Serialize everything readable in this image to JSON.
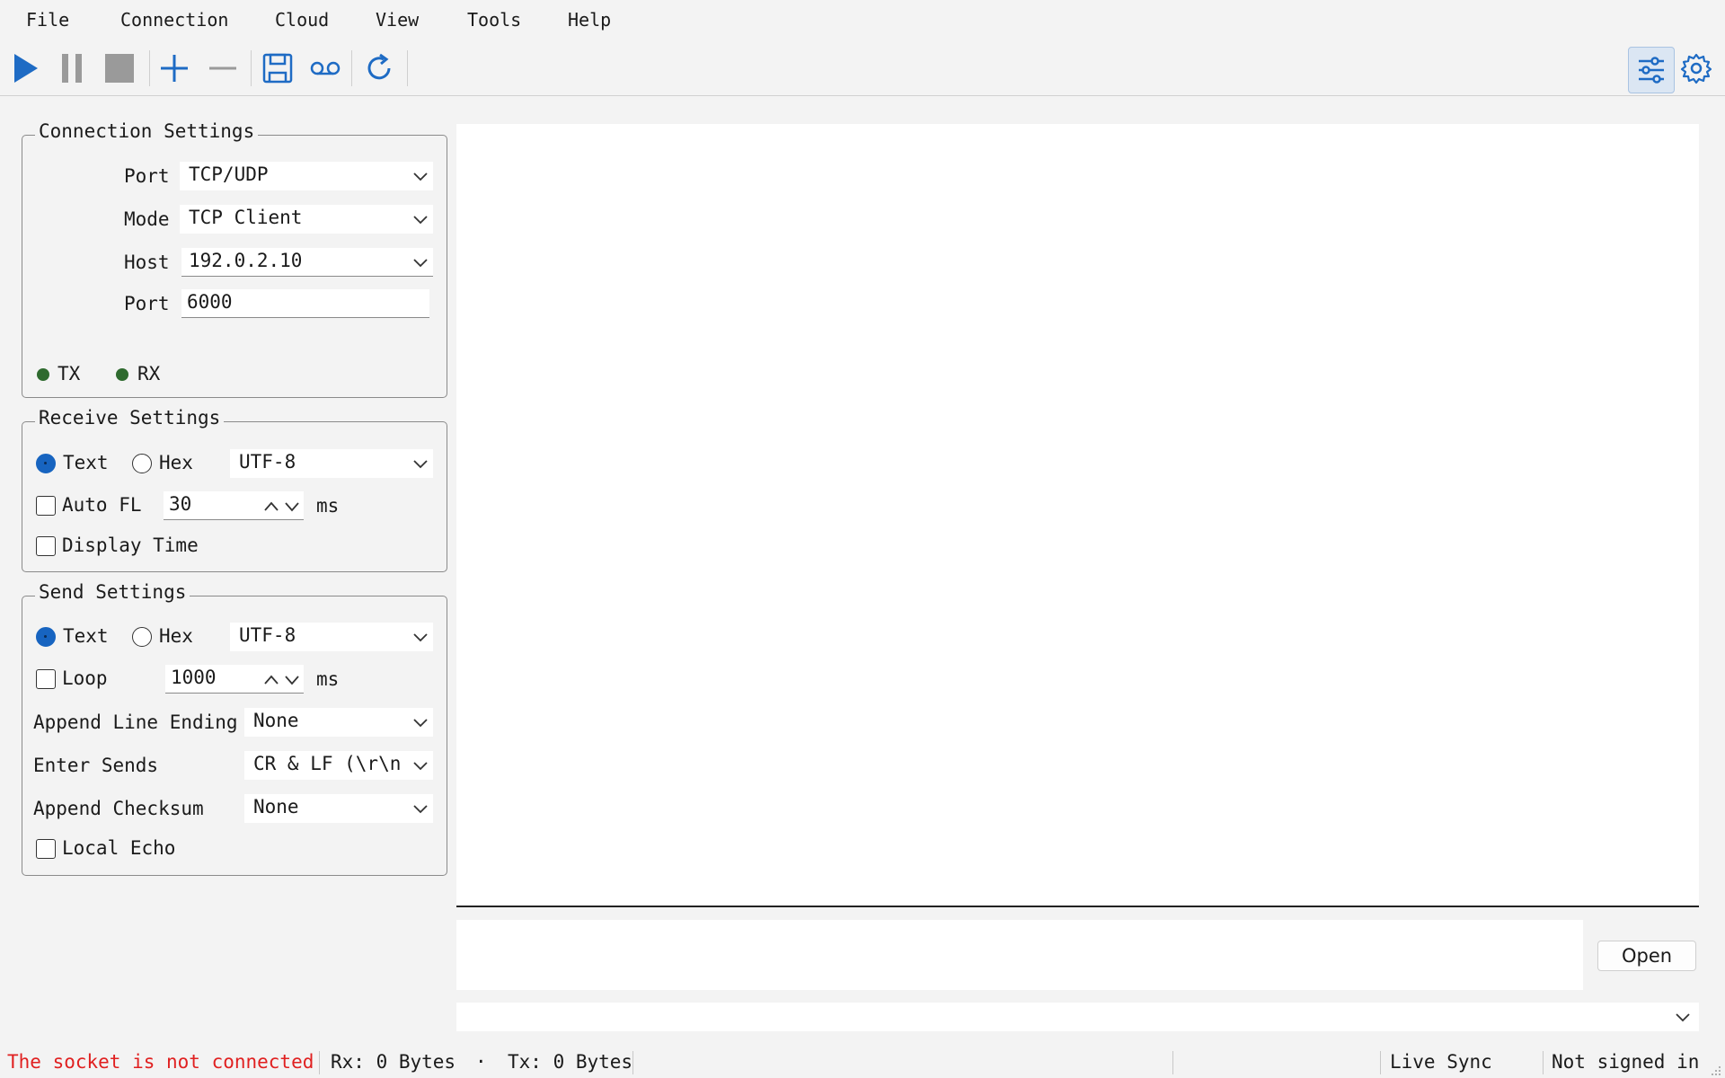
{
  "menu": [
    "File",
    "Connection",
    "Cloud",
    "View",
    "Tools",
    "Help"
  ],
  "toolbar": {
    "icons": [
      "play-icon",
      "pause-icon",
      "stop-icon",
      "plus-icon",
      "minus-icon",
      "save-icon",
      "record-icon",
      "refresh-icon",
      "sliders-icon",
      "gear-icon"
    ],
    "accent": "#1e6bc4"
  },
  "connection": {
    "title": "Connection Settings",
    "port_label": "Port",
    "port_value": "TCP/UDP",
    "mode_label": "Mode",
    "mode_value": "TCP Client",
    "host_label": "Host",
    "host_value": "192.0.2.10",
    "port2_label": "Port",
    "port2_value": "6000",
    "tx_label": "TX",
    "rx_label": "RX",
    "indicator_color": "#2e6a2e"
  },
  "receive": {
    "title": "Receive Settings",
    "text_label": "Text",
    "hex_label": "Hex",
    "encoding": "UTF-8",
    "auto_fl_label": "Auto FL",
    "auto_fl_value": "30",
    "ms_label": "ms",
    "display_time_label": "Display Time"
  },
  "send": {
    "title": "Send Settings",
    "text_label": "Text",
    "hex_label": "Hex",
    "encoding": "UTF-8",
    "loop_label": "Loop",
    "loop_value": "1000",
    "ms_label": "ms",
    "append_line_ending_label": "Append Line Ending",
    "append_line_ending_value": "None",
    "enter_sends_label": "Enter Sends",
    "enter_sends_value": "CR & LF (\\r\\n",
    "append_checksum_label": "Append Checksum",
    "append_checksum_value": "None",
    "local_echo_label": "Local Echo"
  },
  "main": {
    "open_label": "Open"
  },
  "status": {
    "message": "The socket is not connected",
    "message_color": "#e02020",
    "rx": "Rx: 0 Bytes",
    "dot": "·",
    "tx": "Tx: 0 Bytes",
    "live_sync": "Live Sync",
    "signin": "Not signed in"
  }
}
